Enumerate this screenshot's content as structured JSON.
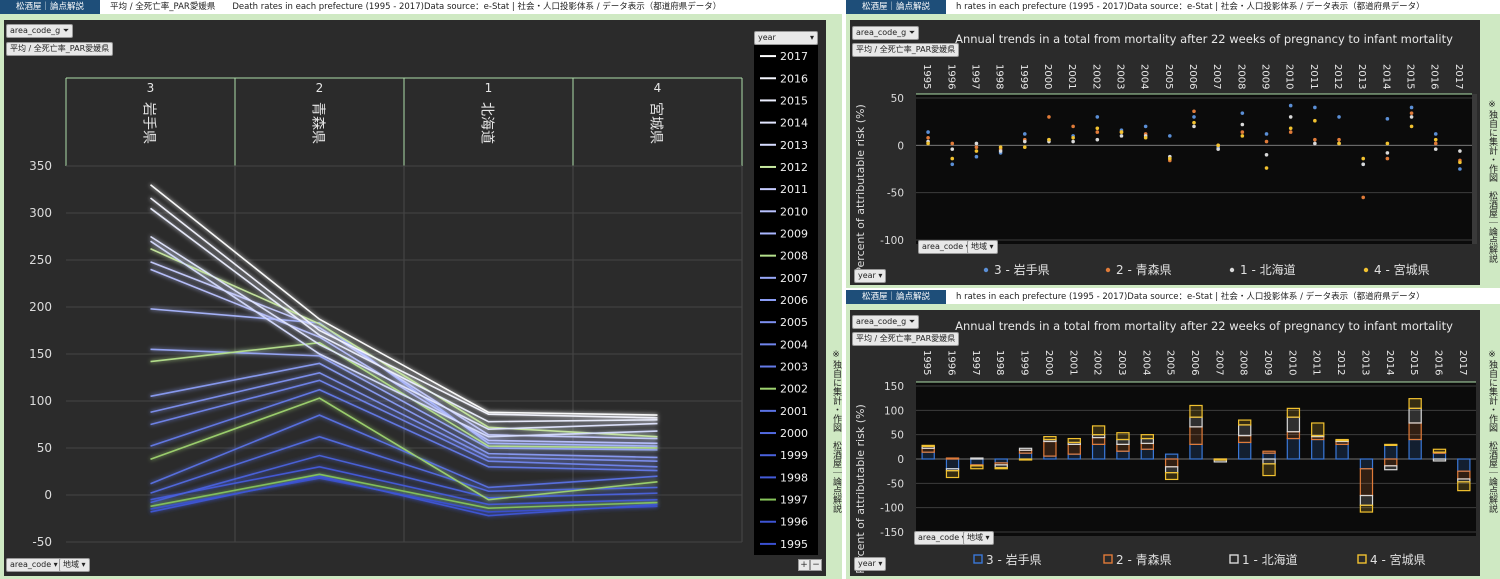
{
  "left": {
    "header_tag": "松酒屋｜論点解説",
    "header_title": "平均 / 全死亡率_PAR愛媛県　　Death rates in each prefecture (1995 - 2017)Data source：e-Stat | 社会・人口投影体系 / データ表示（都道府県データ）",
    "filter_label": "area_code_g",
    "measure_label": "平均 / 全死亡率_PAR愛媛県",
    "legend_title": "year",
    "bottom_filter_1": "area_code",
    "bottom_filter_2": "地域",
    "side_note": "※独自に集計・作図　松酒屋｜論点解説",
    "zoom_in": "+",
    "zoom_out": "−"
  },
  "right_top": {
    "header_tag": "松酒屋｜論点解説",
    "header_title": "h rates in each prefecture (1995 - 2017)Data source：e-Stat | 社会・人口投影体系 / データ表示（都道府県データ）",
    "filter_label": "area_code_g",
    "measure_label": "平均 / 全死亡率_PAR愛媛県",
    "bottom_filter_1": "area_code",
    "bottom_filter_2": "地域",
    "year_filter": "year",
    "side_note": "※独自に集計・作図　松酒屋｜論点解説"
  },
  "right_bottom": {
    "header_tag": "松酒屋｜論点解説",
    "header_title": "h rates in each prefecture (1995 - 2017)Data source：e-Stat | 社会・人口投影体系 / データ表示（都道府県データ）",
    "filter_label": "area_code_g",
    "measure_label": "平均 / 全死亡率_PAR愛媛県",
    "bottom_filter_1": "area_code",
    "bottom_filter_2": "地域",
    "year_filter": "year",
    "side_note": "※独自に集計・作図　松酒屋｜論点解説"
  },
  "chart_data": [
    {
      "type": "line",
      "title": "",
      "categories": [
        "3\n岩手県",
        "2\n青森県",
        "1\n北海道",
        "4\n宮城県"
      ],
      "category_codes": [
        "3",
        "2",
        "1",
        "4"
      ],
      "category_names": [
        "岩手県",
        "青森県",
        "北海道",
        "宮城県"
      ],
      "ylim": [
        -50,
        350
      ],
      "yticks": [
        -50,
        0,
        50,
        100,
        150,
        200,
        250,
        300,
        350
      ],
      "legend_position": "right",
      "series": [
        {
          "name": "2017",
          "values": [
            330,
            187,
            88,
            85
          ],
          "color": "#ffffff"
        },
        {
          "name": "2016",
          "values": [
            316,
            175,
            86,
            82
          ],
          "color": "#f4f6ff"
        },
        {
          "name": "2015",
          "values": [
            305,
            170,
            78,
            80
          ],
          "color": "#ecefff"
        },
        {
          "name": "2014",
          "values": [
            275,
            160,
            70,
            76
          ],
          "color": "#e2e6ff"
        },
        {
          "name": "2013",
          "values": [
            270,
            150,
            62,
            68
          ],
          "color": "#d6dcff"
        },
        {
          "name": "2012",
          "values": [
            262,
            182,
            72,
            62
          ],
          "color": "#c7e8a0"
        },
        {
          "name": "2011",
          "values": [
            248,
            178,
            64,
            60
          ],
          "color": "#c6ccff"
        },
        {
          "name": "2010",
          "values": [
            240,
            168,
            58,
            55
          ],
          "color": "#b9c2ff"
        },
        {
          "name": "2009",
          "values": [
            198,
            183,
            55,
            52
          ],
          "color": "#a9b6ff"
        },
        {
          "name": "2008",
          "values": [
            142,
            162,
            52,
            50
          ],
          "color": "#b5e08c"
        },
        {
          "name": "2007",
          "values": [
            155,
            148,
            50,
            48
          ],
          "color": "#98a8f8"
        },
        {
          "name": "2006",
          "values": [
            105,
            140,
            44,
            40
          ],
          "color": "#8a9cf4"
        },
        {
          "name": "2005",
          "values": [
            88,
            130,
            40,
            36
          ],
          "color": "#7d90f0"
        },
        {
          "name": "2004",
          "values": [
            75,
            122,
            36,
            30
          ],
          "color": "#7085ec"
        },
        {
          "name": "2003",
          "values": [
            52,
            112,
            30,
            26
          ],
          "color": "#647ae8"
        },
        {
          "name": "2002",
          "values": [
            38,
            103,
            -5,
            14
          ],
          "color": "#9ed36f"
        },
        {
          "name": "2001",
          "values": [
            12,
            85,
            8,
            20
          ],
          "color": "#5a72e4"
        },
        {
          "name": "2000",
          "values": [
            2,
            62,
            4,
            8
          ],
          "color": "#526ae0"
        },
        {
          "name": "1999",
          "values": [
            -8,
            42,
            -3,
            2
          ],
          "color": "#4a62dc"
        },
        {
          "name": "1998",
          "values": [
            -5,
            30,
            -10,
            -5
          ],
          "color": "#445bd8"
        },
        {
          "name": "1997",
          "values": [
            -12,
            22,
            -14,
            -8
          ],
          "color": "#86c45a"
        },
        {
          "name": "1996",
          "values": [
            -18,
            20,
            -22,
            -10
          ],
          "color": "#3e55d4"
        },
        {
          "name": "1995",
          "values": [
            -15,
            18,
            -18,
            -12
          ],
          "color": "#3a50d0"
        }
      ]
    },
    {
      "type": "scatter",
      "title": "Annual trends in a total from mortality after 22 weeks of pregnancy to infant mortality",
      "ylabel": "Percent of attributable risk (%)",
      "ylim": [
        -100,
        50
      ],
      "yticks": [
        -100,
        -50,
        0,
        50
      ],
      "x": [
        "1995",
        "1996",
        "1997",
        "1998",
        "1999",
        "2000",
        "2001",
        "2002",
        "2003",
        "2004",
        "2005",
        "2006",
        "2007",
        "2008",
        "2009",
        "2010",
        "2011",
        "2012",
        "2013",
        "2014",
        "2015",
        "2016",
        "2017"
      ],
      "legend_position": "bottom",
      "series": [
        {
          "name": "3 - 岩手県",
          "color": "#5b8fd6",
          "values": [
            14,
            -20,
            -12,
            -8,
            12,
            6,
            10,
            30,
            16,
            20,
            10,
            30,
            -2,
            34,
            12,
            42,
            40,
            30,
            -20,
            28,
            40,
            12,
            -25
          ]
        },
        {
          "name": "2 - 青森県",
          "color": "#e07b39",
          "values": [
            8,
            2,
            -2,
            -4,
            6,
            30,
            20,
            14,
            14,
            12,
            -16,
            36,
            0,
            14,
            4,
            14,
            6,
            6,
            -55,
            -14,
            34,
            2,
            -16
          ]
        },
        {
          "name": "1 - 北海道",
          "color": "#d9d9d9",
          "values": [
            4,
            -4,
            2,
            -6,
            4,
            4,
            4,
            6,
            10,
            10,
            -12,
            20,
            -4,
            22,
            -10,
            30,
            2,
            2,
            -20,
            -8,
            30,
            -4,
            -6
          ]
        },
        {
          "name": "4 - 宮城県",
          "color": "#f2c230",
          "values": [
            2,
            -14,
            -6,
            -2,
            -2,
            6,
            8,
            18,
            14,
            8,
            -14,
            24,
            0,
            10,
            -24,
            18,
            26,
            2,
            -14,
            2,
            20,
            6,
            -18
          ]
        }
      ]
    },
    {
      "type": "bar",
      "title": "Annual trends in a total from mortality after 22 weeks of pregnancy to infant mortality",
      "ylabel": "Percent of attributable risk (%)",
      "ylim": [
        -150,
        150
      ],
      "yticks": [
        -150,
        -100,
        -50,
        0,
        50,
        100,
        150
      ],
      "stacked": true,
      "x": [
        "1995",
        "1996",
        "1997",
        "1998",
        "1999",
        "2000",
        "2001",
        "2002",
        "2003",
        "2004",
        "2005",
        "2006",
        "2007",
        "2008",
        "2009",
        "2010",
        "2011",
        "2012",
        "2013",
        "2014",
        "2015",
        "2016",
        "2017"
      ],
      "legend_position": "bottom",
      "series": [
        {
          "name": "3 - 岩手県",
          "color": "#3a78d8",
          "values": [
            14,
            -20,
            -12,
            -8,
            12,
            6,
            10,
            30,
            16,
            20,
            10,
            30,
            -2,
            34,
            12,
            42,
            40,
            30,
            -20,
            28,
            40,
            12,
            -25
          ]
        },
        {
          "name": "2 - 青森県",
          "color": "#e07b39",
          "values": [
            8,
            2,
            -2,
            -4,
            6,
            30,
            20,
            14,
            14,
            12,
            -16,
            36,
            0,
            14,
            4,
            14,
            6,
            6,
            -55,
            -14,
            34,
            2,
            -16
          ]
        },
        {
          "name": "1 - 北海道",
          "color": "#d9d9d9",
          "values": [
            4,
            -4,
            2,
            -6,
            4,
            4,
            4,
            6,
            10,
            10,
            -12,
            20,
            -4,
            22,
            -10,
            30,
            2,
            2,
            -20,
            -8,
            30,
            -4,
            -6
          ]
        },
        {
          "name": "4 - 宮城県",
          "color": "#f2c230",
          "values": [
            2,
            -14,
            -6,
            -2,
            -2,
            6,
            8,
            18,
            14,
            8,
            -14,
            24,
            0,
            10,
            -24,
            18,
            26,
            2,
            -14,
            2,
            20,
            6,
            -18
          ]
        }
      ]
    }
  ]
}
